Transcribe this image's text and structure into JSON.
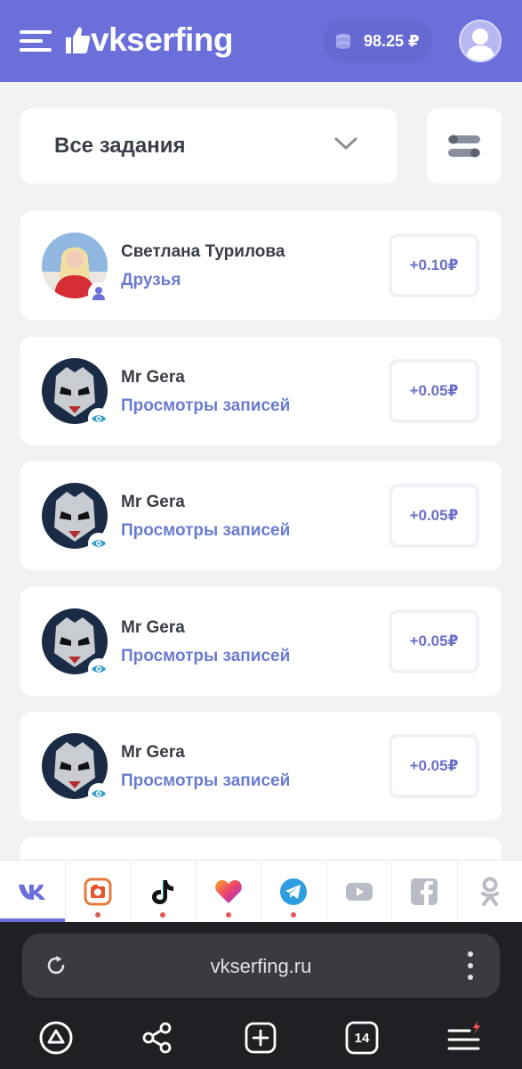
{
  "header": {
    "logo_text": "vkserfing",
    "balance": "98.25 ₽",
    "menu_icon": "hamburger-icon",
    "coins_icon": "coins-icon",
    "profile_icon": "user-avatar-icon"
  },
  "filter": {
    "selected": "Все задания",
    "chevron_icon": "chevron-down-icon",
    "settings_icon": "filter-settings-icon"
  },
  "tasks": [
    {
      "name": "Светлана Турилова",
      "type": "Друзья",
      "reward": "+0.10₽",
      "badge_icon": "person-icon"
    },
    {
      "name": "Mr Gera",
      "type": "Просмотры записей",
      "reward": "+0.05₽",
      "badge_icon": "eye-icon"
    },
    {
      "name": "Mr Gera",
      "type": "Просмотры записей",
      "reward": "+0.05₽",
      "badge_icon": "eye-icon"
    },
    {
      "name": "Mr Gera",
      "type": "Просмотры записей",
      "reward": "+0.05₽",
      "badge_icon": "eye-icon"
    },
    {
      "name": "Mr Gera",
      "type": "Просмотры записей",
      "reward": "+0.05₽",
      "badge_icon": "eye-icon"
    }
  ],
  "social_tabs": [
    {
      "icon": "vk-icon",
      "active": true,
      "has_dot": false
    },
    {
      "icon": "instagram-icon",
      "active": false,
      "has_dot": true
    },
    {
      "icon": "tiktok-icon",
      "active": false,
      "has_dot": true
    },
    {
      "icon": "likee-icon",
      "active": false,
      "has_dot": true
    },
    {
      "icon": "telegram-icon",
      "active": false,
      "has_dot": true
    },
    {
      "icon": "youtube-icon",
      "active": false,
      "has_dot": false
    },
    {
      "icon": "facebook-icon",
      "active": false,
      "has_dot": false
    },
    {
      "icon": "odnoklassniki-icon",
      "active": false,
      "has_dot": false
    }
  ],
  "browser": {
    "url": "vkserfing.ru",
    "tab_count": "14",
    "icons": [
      "reload-icon",
      "more-vertical-icon",
      "alice-icon",
      "share-icon",
      "new-tab-icon",
      "tabs-icon",
      "menu-icon"
    ]
  },
  "colors": {
    "header_bg": "#6b6fd9",
    "accent_text": "#6b7ccf",
    "reward_text": "#6b70c8",
    "notification_dot": "#e15a5a"
  }
}
